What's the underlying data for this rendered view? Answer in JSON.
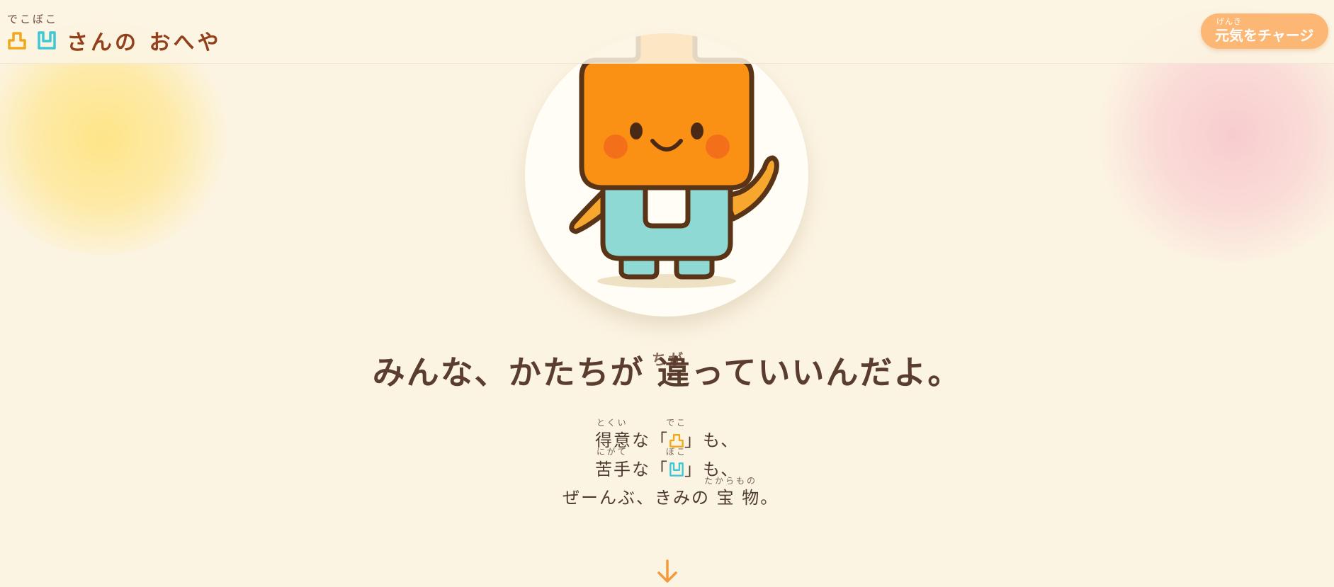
{
  "header": {
    "logo_ruby": "でこぼこ",
    "logo_text": "さんの おへや",
    "logo_icons": [
      "deko-icon",
      "boko-icon"
    ],
    "charge_button": {
      "ruby": "げんき",
      "label": "元気をチャージ"
    }
  },
  "hero": {
    "character": "deko-boko-mascot-illustration",
    "headline": "みんな、かたちが 違っていいんだよ。",
    "headline_ruby": "ちが",
    "lines": [
      {
        "ruby_left": "とくい",
        "ruby_icon": "でこ",
        "text_before": "得意な「",
        "icon": "deko-icon",
        "text_after": "」も、"
      },
      {
        "ruby_left": "にがて",
        "ruby_icon": "ぼこ",
        "text_before": "苦手な「",
        "icon": "boko-icon",
        "text_after": "」も、"
      },
      {
        "ruby_right": "たからもの",
        "text": "ぜーんぶ、きみの 宝 物。"
      }
    ]
  },
  "colors": {
    "background": "#fcf4e3",
    "deko": "#f2a61a",
    "boko": "#3cc8d8",
    "accent_orange": "#fdb774",
    "title_brown": "#93401c",
    "text_brown": "#5a3d2e",
    "arrow": "#f39a3d"
  },
  "scroll_hint_icon": "arrow-down-icon"
}
